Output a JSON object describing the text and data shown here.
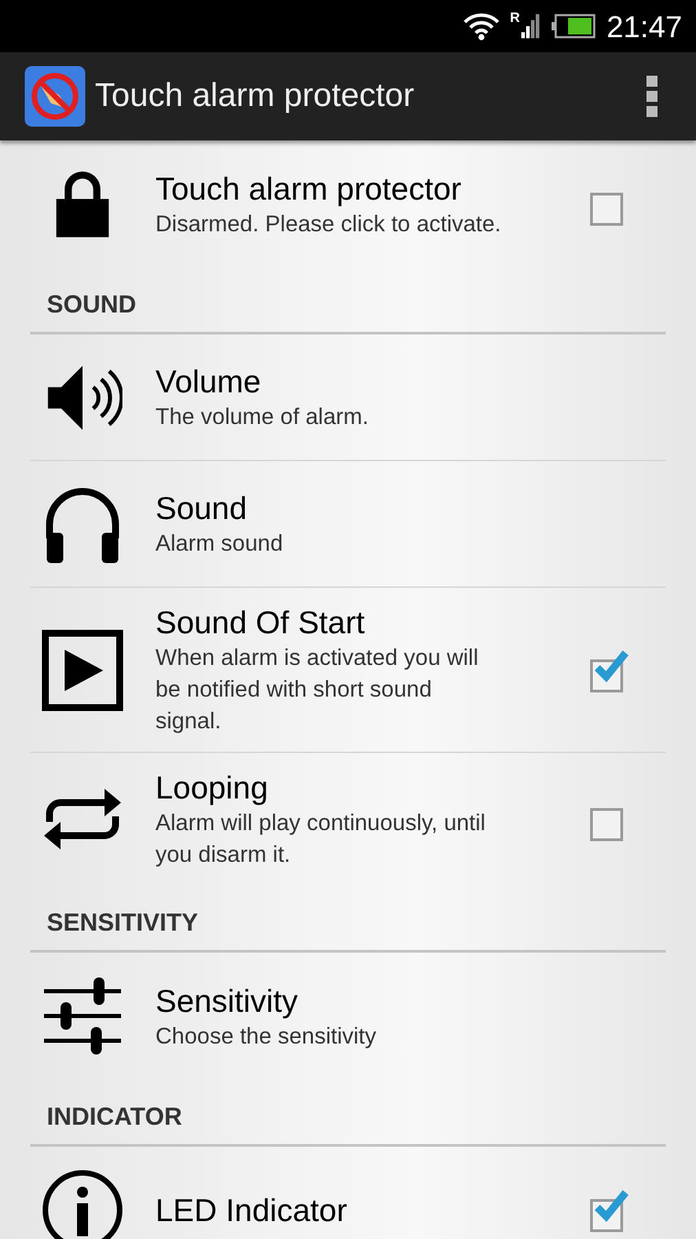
{
  "status_bar": {
    "time": "21:47",
    "roaming": "R"
  },
  "action_bar": {
    "title": "Touch alarm protector"
  },
  "sections": [
    {
      "items": [
        {
          "kind": "checkbox",
          "title": "Touch alarm protector",
          "summary": "Disarmed. Please click to activate.",
          "checked": false
        }
      ]
    },
    {
      "header": "SOUND",
      "items": [
        {
          "kind": "plain",
          "title": "Volume",
          "summary": "The volume of alarm."
        },
        {
          "kind": "plain",
          "title": "Sound",
          "summary": "Alarm sound"
        },
        {
          "kind": "checkbox",
          "title": "Sound Of Start",
          "summary": "When alarm is activated you will be notified with short sound signal.",
          "checked": true
        },
        {
          "kind": "checkbox",
          "title": "Looping",
          "summary": "Alarm will play continuously, until you disarm it.",
          "checked": false
        }
      ]
    },
    {
      "header": "SENSITIVITY",
      "items": [
        {
          "kind": "plain",
          "title": "Sensitivity",
          "summary": "Choose the sensitivity"
        }
      ]
    },
    {
      "header": "INDICATOR",
      "items": [
        {
          "kind": "checkbox",
          "title": "LED Indicator",
          "checked": true
        }
      ]
    }
  ]
}
